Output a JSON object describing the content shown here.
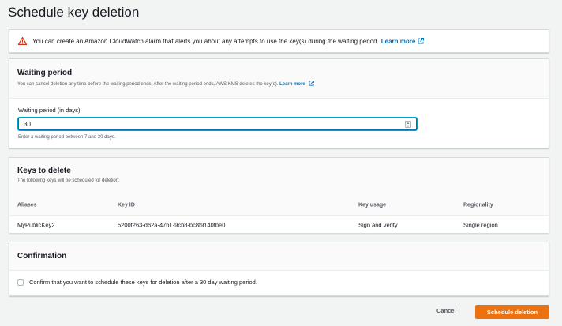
{
  "page": {
    "title": "Schedule key deletion"
  },
  "alert": {
    "icon": "warning-icon",
    "text": "You can create an Amazon CloudWatch alarm that alerts you about any attempts to use the key(s) during the waiting period.",
    "link_label": "Learn more"
  },
  "waiting": {
    "heading": "Waiting period",
    "description": "You can cancel deletion any time before the waiting period ends. After the waiting period ends, AWS KMS deletes the key(s).",
    "link_label": "Learn more",
    "field_label": "Waiting period (in days)",
    "value": "30",
    "constraint": "Enter a waiting period between 7 and 30 days."
  },
  "keys": {
    "heading": "Keys to delete",
    "description": "The following keys will be scheduled for deletion.",
    "columns": [
      "Aliases",
      "Key ID",
      "Key usage",
      "Regionality"
    ],
    "rows": [
      [
        "MyPublicKey2",
        "5200f263-d62a-47b1-9cb8-bc8f9140fbe0",
        "Sign and verify",
        "Single region"
      ]
    ]
  },
  "confirmation": {
    "heading": "Confirmation",
    "checkbox_label": "Confirm that you want to schedule these keys for deletion after a 30 day waiting period.",
    "checked": false
  },
  "actions": {
    "cancel_label": "Cancel",
    "submit_label": "Schedule deletion"
  },
  "colors": {
    "accent": "#ec7211",
    "link": "#0073bb",
    "warning": "#d13212",
    "background": "#f2f3f3"
  }
}
